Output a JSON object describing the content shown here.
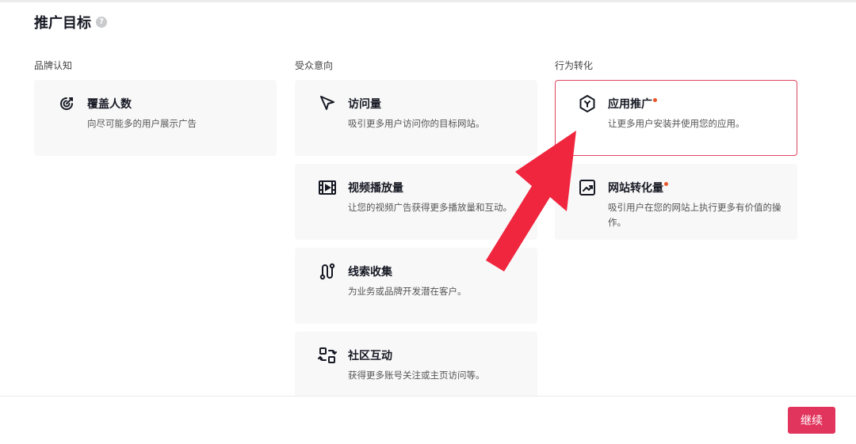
{
  "header": {
    "title": "推广目标",
    "help_icon": "?"
  },
  "columns": [
    {
      "label": "品牌认知",
      "cards": [
        {
          "icon": "target-icon",
          "title": "覆盖人数",
          "desc": "向尽可能多的用户展示广告"
        }
      ]
    },
    {
      "label": "受众意向",
      "cards": [
        {
          "icon": "cursor-icon",
          "title": "访问量",
          "desc": "吸引更多用户访问你的目标网站。"
        },
        {
          "icon": "film-icon",
          "title": "视频播放量",
          "desc": "让您的视频广告获得更多播放量和互动。"
        },
        {
          "icon": "route-icon",
          "title": "线索收集",
          "desc": "为业务或品牌开发潜在客户。"
        },
        {
          "icon": "community-icon",
          "title": "社区互动",
          "desc": "获得更多账号关注或主页访问等。"
        }
      ]
    },
    {
      "label": "行为转化",
      "cards": [
        {
          "icon": "app-icon",
          "title": "应用推广",
          "desc": "让更多用户安装并使用您的应用。",
          "selected": true,
          "new": true
        },
        {
          "icon": "trend-chart-icon",
          "title": "网站转化量",
          "desc": "吸引用户在您的网站上执行更多有价值的操作。",
          "new": true
        }
      ]
    }
  ],
  "footer": {
    "continue_label": "继续"
  },
  "colors": {
    "accent": "#e2355e",
    "selected_border": "#e0455f",
    "arrow": "#f0253e",
    "new_dot": "#e8572a"
  }
}
